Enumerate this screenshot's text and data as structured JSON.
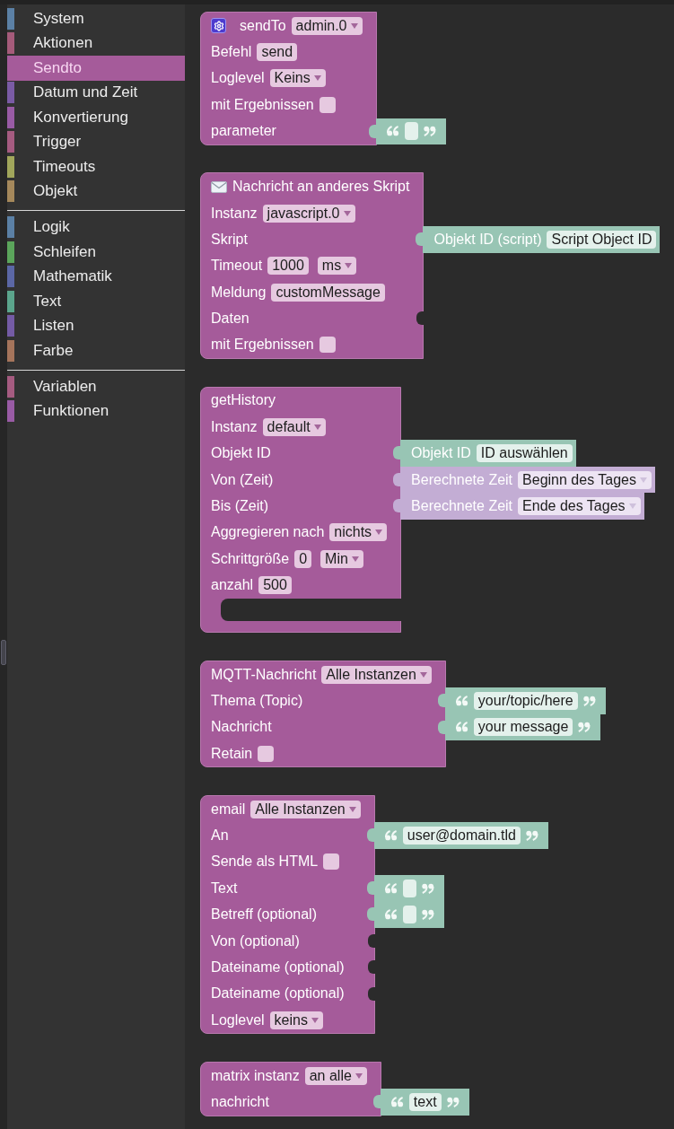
{
  "sidebar": {
    "sections": [
      {
        "items": [
          {
            "label": "System",
            "color": "#5b80a5",
            "selected": false
          },
          {
            "label": "Aktionen",
            "color": "#a55b7a",
            "selected": false
          },
          {
            "label": "Sendto",
            "color": "#a55b9a",
            "selected": true
          },
          {
            "label": "Datum und Zeit",
            "color": "#7a5ba5",
            "selected": false
          },
          {
            "label": "Konvertierung",
            "color": "#995ba5",
            "selected": false
          },
          {
            "label": "Trigger",
            "color": "#a55b80",
            "selected": false
          },
          {
            "label": "Timeouts",
            "color": "#a1a65b",
            "selected": false
          },
          {
            "label": "Objekt",
            "color": "#a5885b",
            "selected": false
          }
        ]
      },
      {
        "items": [
          {
            "label": "Logik",
            "color": "#5b80a5",
            "selected": false
          },
          {
            "label": "Schleifen",
            "color": "#5ba55b",
            "selected": false
          },
          {
            "label": "Mathematik",
            "color": "#5b67a5",
            "selected": false
          },
          {
            "label": "Text",
            "color": "#5ba58c",
            "selected": false
          },
          {
            "label": "Listen",
            "color": "#745ba5",
            "selected": false
          },
          {
            "label": "Farbe",
            "color": "#a5745b",
            "selected": false
          }
        ]
      },
      {
        "items": [
          {
            "label": "Variablen",
            "color": "#a55b80",
            "selected": false
          },
          {
            "label": "Funktionen",
            "color": "#995ba5",
            "selected": false
          }
        ]
      }
    ]
  },
  "workspace": {
    "blocks": [
      {
        "kind": "sendto",
        "rows": [
          {
            "kind": "dummy",
            "label": "sendTo",
            "fields": [
              {
                "kind": "dropdown",
                "value": "admin.0"
              }
            ]
          },
          {
            "kind": "dummy",
            "label": "Befehl",
            "fields": [
              {
                "kind": "input",
                "value": "send"
              }
            ]
          },
          {
            "kind": "dummy",
            "label": "Loglevel",
            "fields": [
              {
                "kind": "dropdown",
                "value": "Keins"
              }
            ]
          },
          {
            "kind": "dummy",
            "label": "mit Ergebnissen",
            "fields": [
              {
                "kind": "checkbox",
                "checked": false
              }
            ]
          },
          {
            "kind": "value",
            "label": "parameter",
            "attached": {
              "kind": "text"
            }
          }
        ]
      },
      {
        "kind": "message",
        "rows": [
          {
            "kind": "dummy",
            "label": "Nachricht an anderes Skript"
          },
          {
            "kind": "dummy",
            "label": "Instanz",
            "fields": [
              {
                "kind": "dropdown",
                "value": "javascript.0"
              }
            ]
          },
          {
            "kind": "value",
            "label": "Skript",
            "attached": {
              "kind": "object_id",
              "label": "Objekt ID (script)",
              "field": {
                "kind": "input",
                "value": "Script Object ID"
              }
            }
          },
          {
            "kind": "dummy",
            "label": "Timeout",
            "fields": [
              {
                "kind": "input",
                "value": "1000"
              },
              {
                "kind": "dropdown",
                "value": "ms"
              }
            ]
          },
          {
            "kind": "dummy",
            "label": "Meldung",
            "fields": [
              {
                "kind": "input",
                "value": "customMessage"
              }
            ]
          },
          {
            "kind": "value",
            "label": "Daten"
          },
          {
            "kind": "dummy",
            "label": "mit Ergebnissen",
            "fields": [
              {
                "kind": "checkbox",
                "checked": false
              }
            ]
          }
        ]
      },
      {
        "kind": "history",
        "rows": [
          {
            "kind": "dummy",
            "label": "getHistory"
          },
          {
            "kind": "dummy",
            "label": "Instanz",
            "fields": [
              {
                "kind": "dropdown",
                "value": "default"
              }
            ]
          },
          {
            "kind": "value",
            "label": "Objekt ID",
            "attached": {
              "kind": "object_id",
              "label": "Objekt ID",
              "field": {
                "kind": "input",
                "value": "ID auswählen"
              }
            }
          },
          {
            "kind": "value",
            "label": "Von (Zeit)",
            "attached": {
              "kind": "time",
              "label": "Berechnete Zeit",
              "field": {
                "kind": "dropdown",
                "value": "Beginn des Tages"
              }
            }
          },
          {
            "kind": "value",
            "label": "Bis (Zeit)",
            "attached": {
              "kind": "time",
              "label": "Berechnete Zeit",
              "field": {
                "kind": "dropdown",
                "value": "Ende des Tages"
              }
            }
          },
          {
            "kind": "dummy",
            "label": "Aggregieren nach",
            "fields": [
              {
                "kind": "dropdown",
                "value": "nichts"
              }
            ]
          },
          {
            "kind": "dummy",
            "label": "Schrittgröße",
            "fields": [
              {
                "kind": "input",
                "value": "0"
              },
              {
                "kind": "dropdown",
                "value": "Min"
              }
            ]
          },
          {
            "kind": "dummy",
            "label": "anzahl",
            "fields": [
              {
                "kind": "input",
                "value": "500"
              }
            ]
          },
          {
            "kind": "statement"
          }
        ]
      },
      {
        "kind": "mqtt",
        "rows": [
          {
            "kind": "dummy",
            "label": "MQTT-Nachricht",
            "fields": [
              {
                "kind": "dropdown",
                "value": "Alle Instanzen"
              }
            ]
          },
          {
            "kind": "value",
            "label": "Thema (Topic)",
            "attached": {
              "kind": "text",
              "value": "your/topic/here"
            }
          },
          {
            "kind": "value",
            "label": "Nachricht",
            "attached": {
              "kind": "text",
              "value": "your message"
            }
          },
          {
            "kind": "dummy",
            "label": "Retain",
            "fields": [
              {
                "kind": "checkbox",
                "checked": false
              }
            ]
          }
        ]
      },
      {
        "kind": "email",
        "rows": [
          {
            "kind": "dummy",
            "label": "email",
            "fields": [
              {
                "kind": "dropdown",
                "value": "Alle Instanzen"
              }
            ]
          },
          {
            "kind": "value",
            "label": "An",
            "attached": {
              "kind": "text",
              "value": "user@domain.tld"
            }
          },
          {
            "kind": "dummy",
            "label": "Sende als HTML",
            "fields": [
              {
                "kind": "checkbox",
                "checked": false
              }
            ]
          },
          {
            "kind": "value",
            "label": "Text",
            "attached": {
              "kind": "text"
            }
          },
          {
            "kind": "value",
            "label": "Betreff (optional)",
            "attached": {
              "kind": "text"
            }
          },
          {
            "kind": "value",
            "label": "Von (optional)"
          },
          {
            "kind": "value",
            "label": "Dateiname (optional)"
          },
          {
            "kind": "value",
            "label": "Dateiname (optional)"
          },
          {
            "kind": "dummy",
            "label": "Loglevel",
            "fields": [
              {
                "kind": "dropdown",
                "value": "keins"
              }
            ]
          }
        ]
      },
      {
        "kind": "matrix",
        "rows": [
          {
            "kind": "dummy",
            "label": "matrix instanz",
            "fields": [
              {
                "kind": "dropdown",
                "value": "an alle"
              }
            ]
          },
          {
            "kind": "value",
            "label": "nachricht",
            "attached": {
              "kind": "text",
              "value": "text"
            }
          }
        ]
      }
    ]
  }
}
